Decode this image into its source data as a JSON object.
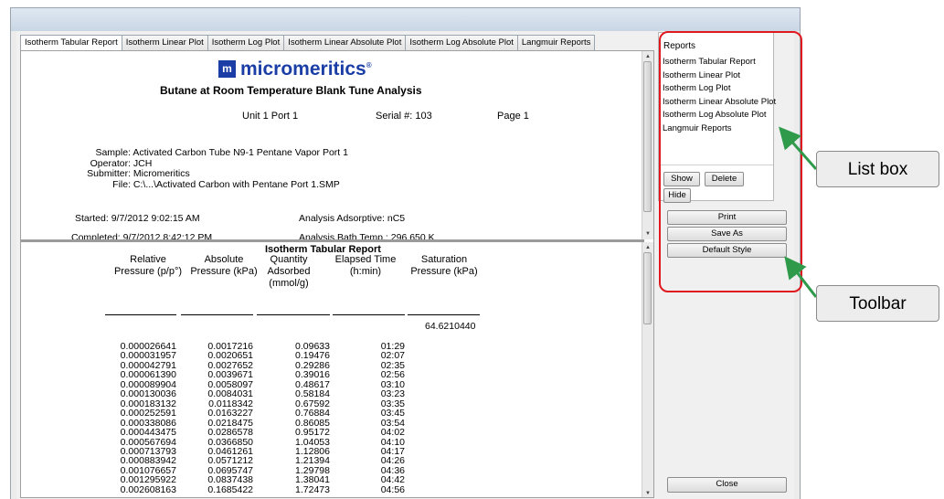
{
  "tabs": [
    "Isotherm Tabular Report",
    "Isotherm Linear Plot",
    "Isotherm Log Plot",
    "Isotherm Linear Absolute Plot",
    "Isotherm Log Absolute Plot",
    "Langmuir Reports"
  ],
  "header": {
    "logo": "micromeritics",
    "logo_reg": "®",
    "logo_mark": "m",
    "title": "Butane at Room Temperature Blank Tune Analysis",
    "unit_port": "Unit 1 Port 1",
    "serial": "Serial #: 103",
    "page": "Page  1"
  },
  "info": [
    {
      "label": "Sample:",
      "value": "Activated Carbon Tube N9-1 Pentane Vapor Port 1"
    },
    {
      "label": "Operator:",
      "value": "JCH"
    },
    {
      "label": "Submitter:",
      "value": "Micromeritics"
    },
    {
      "label": "File:",
      "value": "C:\\...\\Activated Carbon with Pentane Port 1.SMP"
    }
  ],
  "timing": {
    "started": "Started: 9/7/2012 9:02:15 AM",
    "completed": "Completed: 9/7/2012 8:42:12 PM",
    "adsorptive": "Analysis Adsorptive: nC5",
    "bath": "Analysis Bath Temp.: 296.650 K"
  },
  "table": {
    "title": "Isotherm Tabular Report",
    "headers": [
      "Relative\nPressure (p/p°)",
      "Absolute\nPressure (kPa)",
      "Quantity\nAdsorbed\n(mmol/g)",
      "Elapsed Time\n(h:min)",
      "Saturation\nPressure (kPa)"
    ],
    "saturation": "64.6210440",
    "rows": [
      [
        "0.000026641",
        "0.0017216",
        "0.09633",
        "01:29"
      ],
      [
        "0.000031957",
        "0.0020651",
        "0.19476",
        "02:07"
      ],
      [
        "0.000042791",
        "0.0027652",
        "0.29286",
        "02:35"
      ],
      [
        "0.000061390",
        "0.0039671",
        "0.39016",
        "02:56"
      ],
      [
        "0.000089904",
        "0.0058097",
        "0.48617",
        "03:10"
      ],
      [
        "0.000130036",
        "0.0084031",
        "0.58184",
        "03:23"
      ],
      [
        "0.000183132",
        "0.0118342",
        "0.67592",
        "03:35"
      ],
      [
        "0.000252591",
        "0.0163227",
        "0.76884",
        "03:45"
      ],
      [
        "0.000338086",
        "0.0218475",
        "0.86085",
        "03:54"
      ],
      [
        "0.000443475",
        "0.0286578",
        "0.95172",
        "04:02"
      ],
      [
        "0.000567694",
        "0.0366850",
        "1.04053",
        "04:10"
      ],
      [
        "0.000713793",
        "0.0461261",
        "1.12806",
        "04:17"
      ],
      [
        "0.000883942",
        "0.0571212",
        "1.21394",
        "04:26"
      ],
      [
        "0.001076657",
        "0.0695747",
        "1.29798",
        "04:36"
      ],
      [
        "0.001295922",
        "0.0837438",
        "1.38041",
        "04:42"
      ],
      [
        "0.002608163",
        "0.1685422",
        "1.72473",
        "04:56"
      ]
    ]
  },
  "sidebar": {
    "reports_title": "Reports",
    "items": [
      "Isotherm Tabular Report",
      "Isotherm Linear Plot",
      "Isotherm Log Plot",
      "Isotherm Linear Absolute Plot",
      "Isotherm Log Absolute Plot",
      "Langmuir Reports"
    ],
    "show": "Show",
    "delete": "Delete",
    "hide": "Hide",
    "print": "Print",
    "save_as": "Save As",
    "default_style": "Default Style",
    "close": "Close"
  },
  "callouts": {
    "list_box": "List box",
    "toolbar": "Toolbar"
  },
  "colors": {
    "highlight": "#e0191f",
    "callout_arrow": "#2e9a4a",
    "logo": "#1b3ea6"
  }
}
